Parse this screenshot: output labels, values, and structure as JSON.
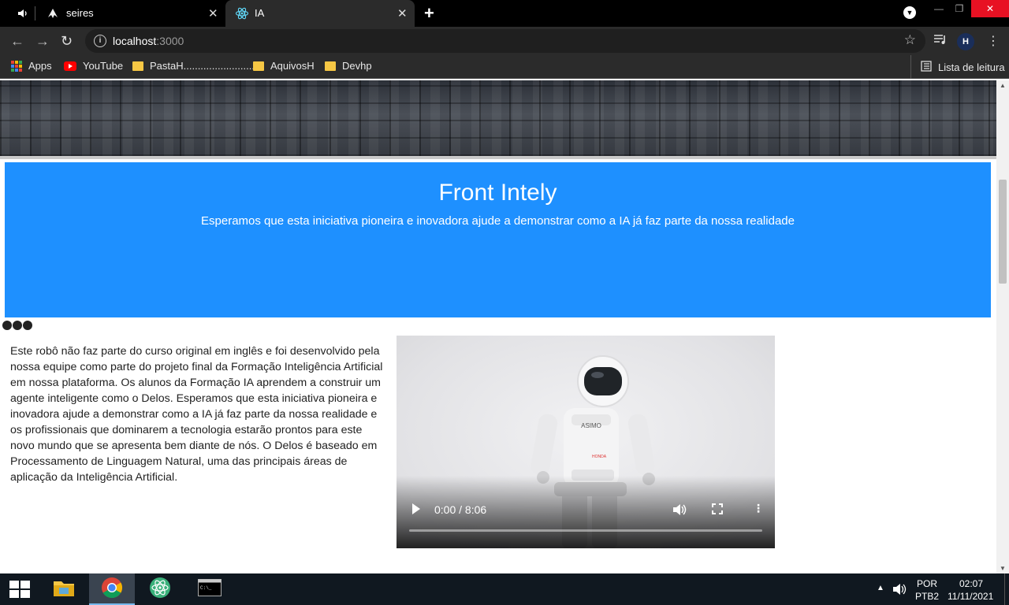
{
  "browser": {
    "tabs": [
      {
        "title": "seires",
        "close": "✕"
      },
      {
        "title": "IA",
        "close": "✕"
      }
    ],
    "new_tab": "+",
    "url_host": "localhost",
    "url_port": ":3000",
    "bookmarks": [
      {
        "label": "Apps",
        "icon": "apps-grid-icon"
      },
      {
        "label": "YouTube",
        "icon": "youtube-icon"
      },
      {
        "label": "PastaH..........................",
        "icon": "folder-icon"
      },
      {
        "label": "AquivosH",
        "icon": "folder-icon"
      },
      {
        "label": "Devhp",
        "icon": "folder-icon"
      }
    ],
    "reading_list": "Lista de leitura",
    "profile_initial": "H"
  },
  "page": {
    "banner": {
      "title": "Front Intely",
      "subtitle": "Esperamos que esta iniciativa pioneira e inovadora ajude a demonstrar como a IA já faz parte da nossa realidade"
    },
    "article": "Este robô não faz parte do curso original em inglês e foi desenvolvido pela nossa equipe como parte do projeto final da Formação Inteligência Artificial em nossa plataforma. Os alunos da Formação IA aprendem a construir um agente inteligente como o Delos. Esperamos que esta iniciativa pioneira e inovadora ajude a demonstrar como a IA já faz parte da nossa realidade e os profissionais que dominarem a tecnologia estarão prontos para este novo mundo que se apresenta bem diante de nós. O Delos é baseado em Processamento de Linguagem Natural, uma das principais áreas de aplicação da Inteligência Artificial.",
    "video": {
      "time": "0:00 / 8:06",
      "robot_label": "ASIMO",
      "robot_brand": "HONDA",
      "progress": 0
    }
  },
  "taskbar": {
    "language_top": "POR",
    "language_bottom": "PTB2",
    "time": "02:07",
    "date": "11/11/2021"
  },
  "colors": {
    "banner": "#1e90ff",
    "tab_bar": "#000000",
    "toolbar": "#2b2b2b",
    "taskbar": "#101820"
  }
}
